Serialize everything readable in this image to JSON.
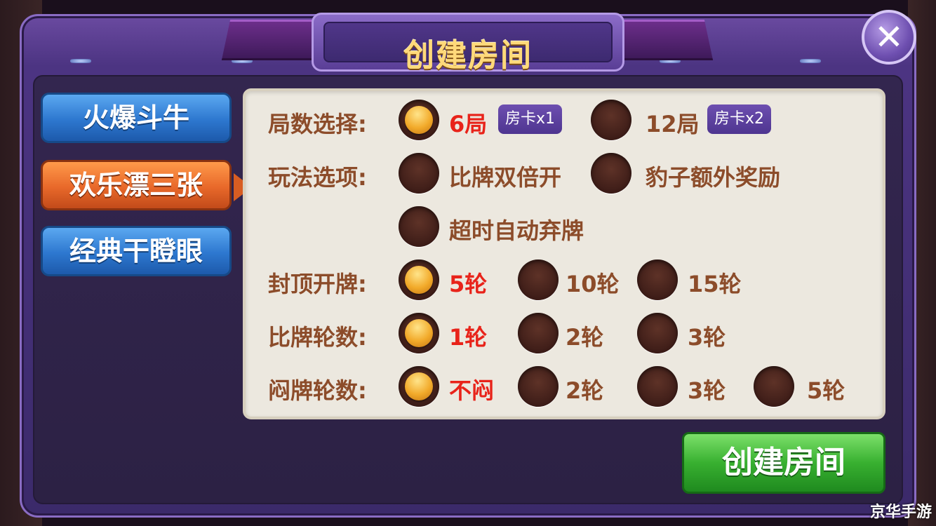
{
  "dialog": {
    "title": "创建房间",
    "close_symbol": "✕"
  },
  "tabs": [
    {
      "label": "火爆斗牛",
      "color": "blue",
      "selected": false
    },
    {
      "label": "欢乐漂三张",
      "color": "orange",
      "selected": true
    },
    {
      "label": "经典干瞪眼",
      "color": "blue",
      "selected": false
    }
  ],
  "rows": {
    "rounds": {
      "label": "局数选择:",
      "options": [
        {
          "label": "6局",
          "badge": "房卡x1",
          "selected": true
        },
        {
          "label": "12局",
          "badge": "房卡x2",
          "selected": false
        }
      ]
    },
    "play": {
      "label": "玩法选项:",
      "options": [
        {
          "label": "比牌双倍开",
          "selected": false
        },
        {
          "label": "豹子额外奖励",
          "selected": false
        },
        {
          "label": "超时自动弃牌",
          "selected": false
        }
      ]
    },
    "cap": {
      "label": "封顶开牌:",
      "options": [
        {
          "label": "5轮",
          "selected": true
        },
        {
          "label": "10轮",
          "selected": false
        },
        {
          "label": "15轮",
          "selected": false
        }
      ]
    },
    "compare": {
      "label": "比牌轮数:",
      "options": [
        {
          "label": "1轮",
          "selected": true
        },
        {
          "label": "2轮",
          "selected": false
        },
        {
          "label": "3轮",
          "selected": false
        }
      ]
    },
    "blind": {
      "label": "闷牌轮数:",
      "options": [
        {
          "label": "不闷",
          "selected": true
        },
        {
          "label": "2轮",
          "selected": false
        },
        {
          "label": "3轮",
          "selected": false
        },
        {
          "label": "5轮",
          "selected": false
        }
      ]
    }
  },
  "create_button": {
    "label": "创建房间"
  },
  "watermark": "京华手游",
  "colors": {
    "label_brown": "#8c4c2a",
    "selected_red": "#e8231a",
    "accent_gold": "#ffd97a",
    "button_green": "#38b030"
  }
}
